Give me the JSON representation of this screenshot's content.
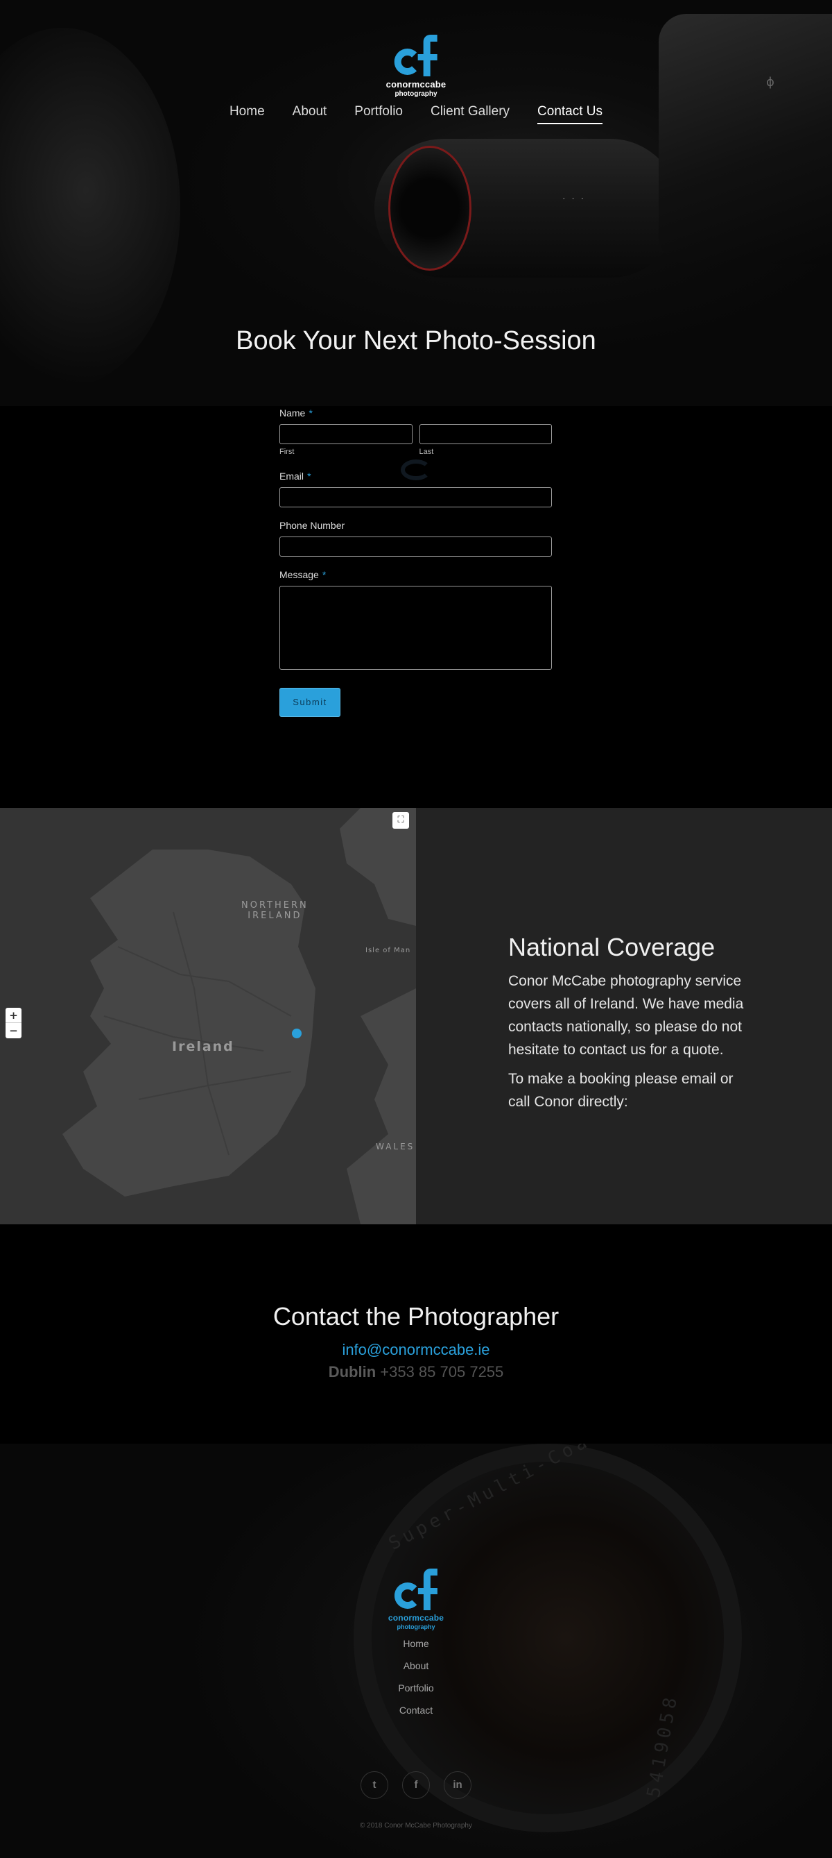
{
  "brand": {
    "name": "conormccabe",
    "tagline": "photography",
    "accent": "#2aa0db"
  },
  "nav": {
    "items": [
      {
        "label": "Home"
      },
      {
        "label": "About"
      },
      {
        "label": "Portfolio"
      },
      {
        "label": "Client Gallery"
      },
      {
        "label": "Contact Us",
        "active": true
      }
    ]
  },
  "hero": {
    "title": "Book Your Next Photo-Session"
  },
  "form": {
    "name_label": "Name",
    "required_mark": "*",
    "first_label": "First",
    "last_label": "Last",
    "email_label": "Email",
    "phone_label": "Phone Number",
    "message_label": "Message",
    "submit_label": "Submit"
  },
  "map": {
    "labels": {
      "northern_ireland_1": "NORTHERN",
      "northern_ireland_2": "IRELAND",
      "isle_of_man": "Isle of Man",
      "ireland": "Ireland",
      "wales": "WALES"
    },
    "zoom_in": "+",
    "zoom_out": "−",
    "fullscreen": "⛶"
  },
  "coverage": {
    "title": "National Coverage",
    "paragraph_1": "Conor McCabe photography service covers all of Ireland. We have media contacts nationally, so please do not hesitate to contact us for a quote.",
    "paragraph_2": "To make a booking please email or call Conor directly:"
  },
  "contact": {
    "title": "Contact the Photographer",
    "email": "info@conormccabe.ie",
    "city": "Dublin",
    "phone": "+353 85 705 7255"
  },
  "footer": {
    "links": [
      {
        "label": "Home"
      },
      {
        "label": "About"
      },
      {
        "label": "Portfolio"
      },
      {
        "label": "Contact"
      }
    ],
    "social": {
      "twitter": "t",
      "facebook": "f",
      "linkedin": "in"
    },
    "copyright": "© 2018 Conor McCabe Photography"
  }
}
